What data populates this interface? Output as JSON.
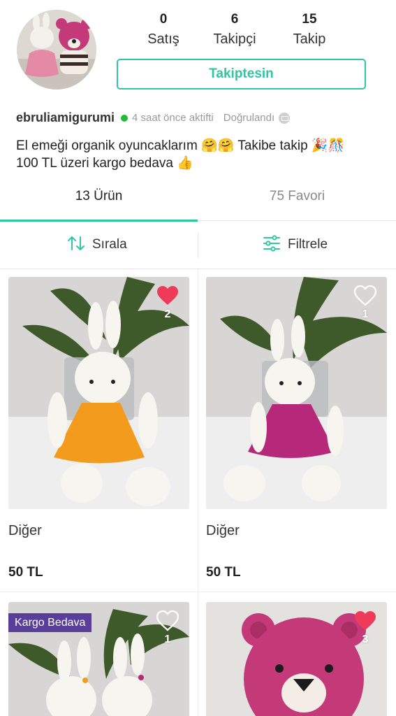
{
  "profile": {
    "stats": [
      {
        "value": "0",
        "label": "Satış"
      },
      {
        "value": "6",
        "label": "Takipçi"
      },
      {
        "value": "15",
        "label": "Takip"
      }
    ],
    "follow_button": "Takiptesin",
    "username": "ebruliamigurumi",
    "last_active": "4 saat önce aktifti",
    "verified": "Doğrulandı",
    "bio_line1": "El emeği organik oyuncaklarım 🤗🤗 Takibe takip 🎉🎊",
    "bio_line2": "100 TL üzeri kargo bedava 👍"
  },
  "tabs": [
    {
      "label": "13 Ürün"
    },
    {
      "label": "75 Favori"
    }
  ],
  "actions": {
    "sort": "Sırala",
    "filter": "Filtrele"
  },
  "products": [
    {
      "title": "Diğer",
      "price": "50 TL",
      "likes": "2",
      "liked": true,
      "dress_color": "#f29b1d"
    },
    {
      "title": "Diğer",
      "price": "50 TL",
      "likes": "1",
      "liked": false,
      "dress_color": "#b5287a"
    },
    {
      "badge": "Kargo Bedava",
      "likes": "1",
      "liked": false
    },
    {
      "likes": "3",
      "liked": true
    }
  ],
  "colors": {
    "accent": "#2fc7a2",
    "like": "#ef3b5a",
    "badge": "#5a3e9c",
    "online": "#22bb33"
  }
}
